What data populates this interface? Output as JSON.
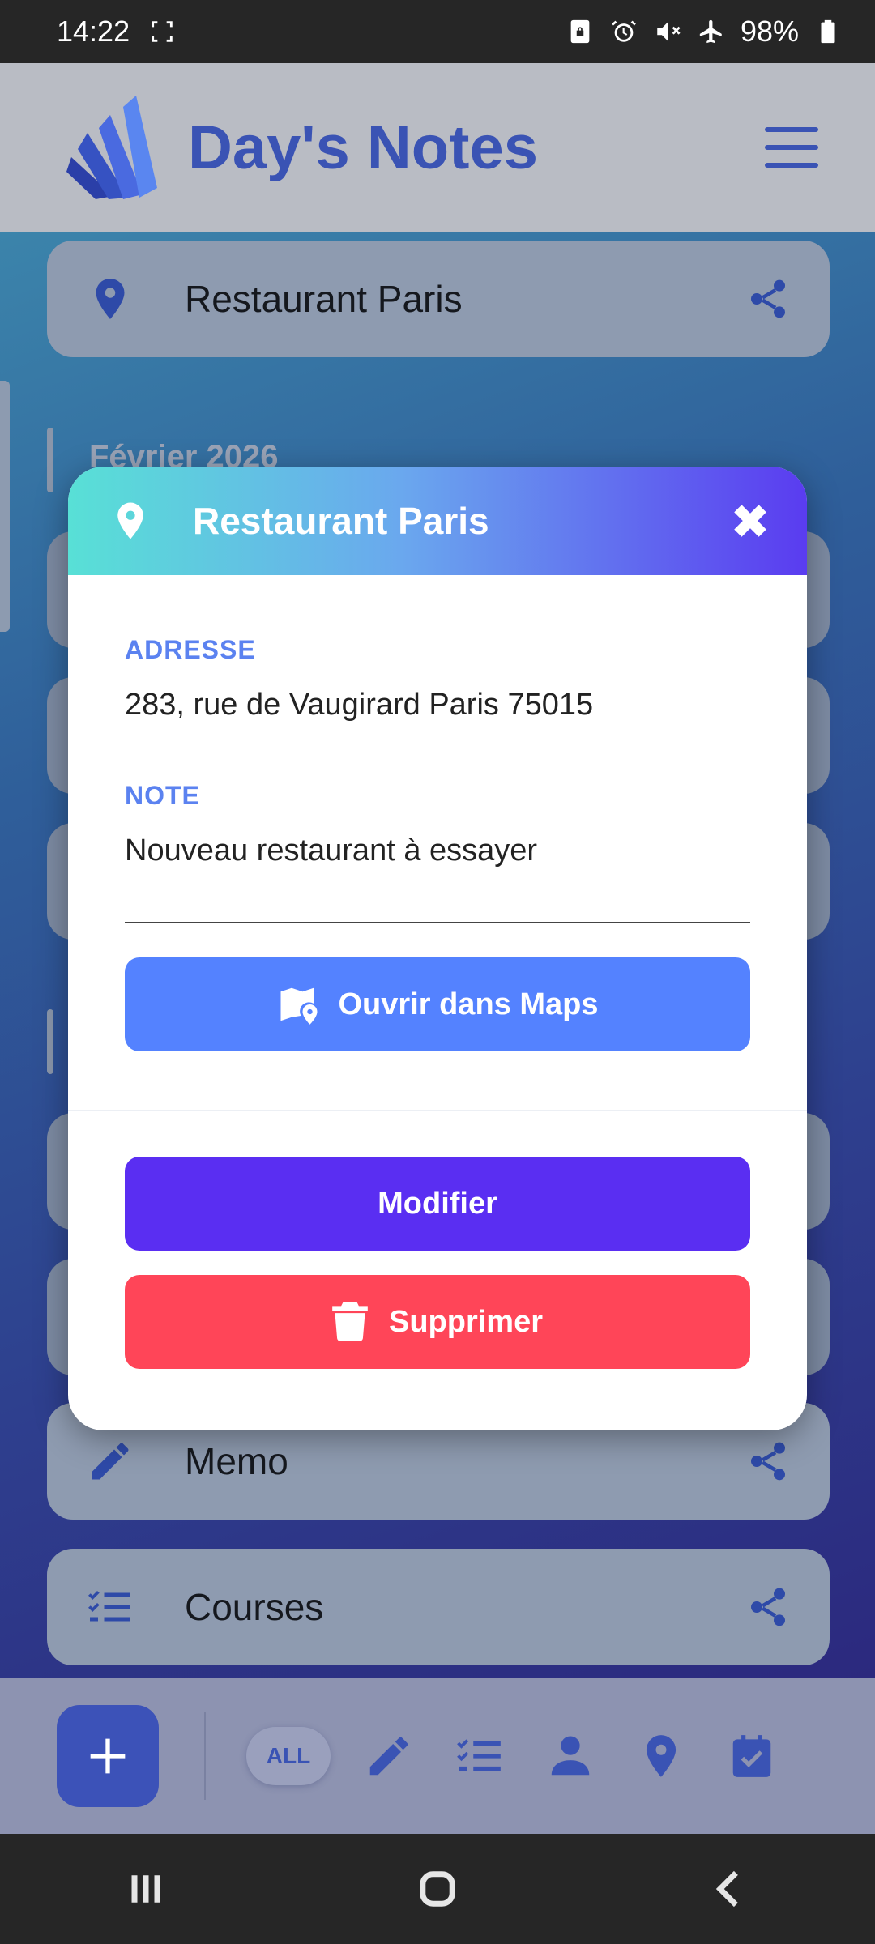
{
  "status": {
    "time": "14:22",
    "battery": "98%"
  },
  "app": {
    "title": "Day's Notes"
  },
  "list": {
    "top_card": "Restaurant Paris",
    "section": "Février 2026",
    "memo": "Memo",
    "courses": "Courses"
  },
  "filters": {
    "all_label": "ALL"
  },
  "dialog": {
    "title": "Restaurant Paris",
    "address_label": "ADRESSE",
    "address_value": "283, rue de Vaugirard Paris 75015",
    "note_label": "NOTE",
    "note_value": "Nouveau restaurant à essayer",
    "maps_label": "Ouvrir dans Maps",
    "edit_label": "Modifier",
    "delete_label": "Supprimer"
  },
  "colors": {
    "accent": "#5a2ef2",
    "maps_button": "#5482ff",
    "delete_button": "#ff4558",
    "field_label": "#5b82f0"
  },
  "icons": [
    "location-icon",
    "share-icon",
    "close-icon",
    "map-icon",
    "trash-icon",
    "pencil-icon",
    "checklist-icon",
    "person-icon",
    "calendar-check-icon",
    "plus-icon",
    "menu-icon"
  ]
}
